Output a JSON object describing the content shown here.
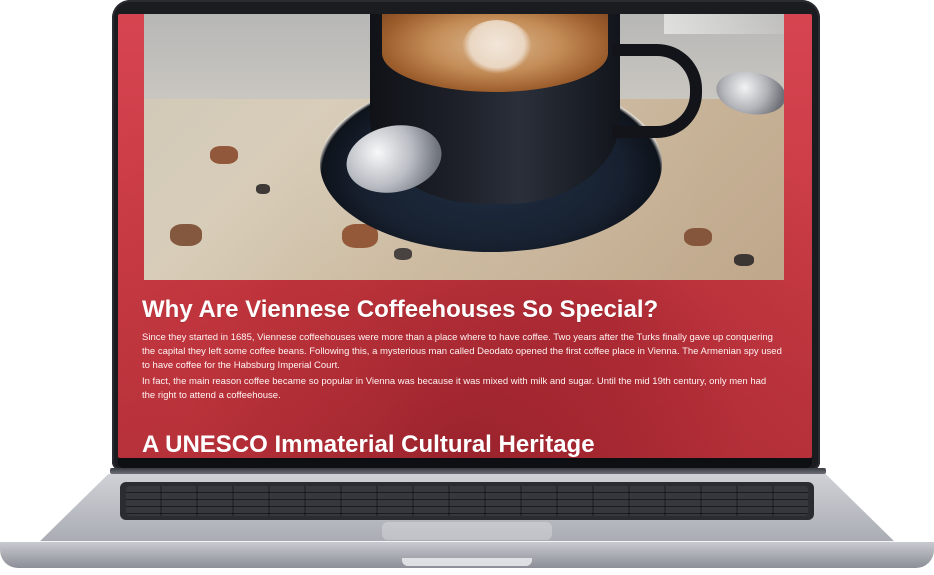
{
  "page": {
    "heading": "Why Are Viennese Coffeehouses So Special?",
    "paragraph_1": "Since they started in 1685, Viennese coffeehouses were more than a place where to have coffee. Two years after the Turks finally gave up conquering the capital they left some coffee beans. Following this, a mysterious man called Deodato opened the first coffee place in Vienna. The Armenian spy used to have coffee for the Habsburg Imperial Court.",
    "paragraph_2": "In fact, the main reason coffee became so popular in Vienna was because it was mixed with milk and sugar. Until the mid 19th century, only men had the right to attend a coffeehouse.",
    "subheading": "A UNESCO Immaterial Cultural Heritage"
  },
  "colors": {
    "page_background": "#c83b44",
    "laptop_bezel": "#1b1c20",
    "laptop_base": "#b7b9bf"
  },
  "icons": {
    "hero_image": "coffee-cup-photo"
  }
}
